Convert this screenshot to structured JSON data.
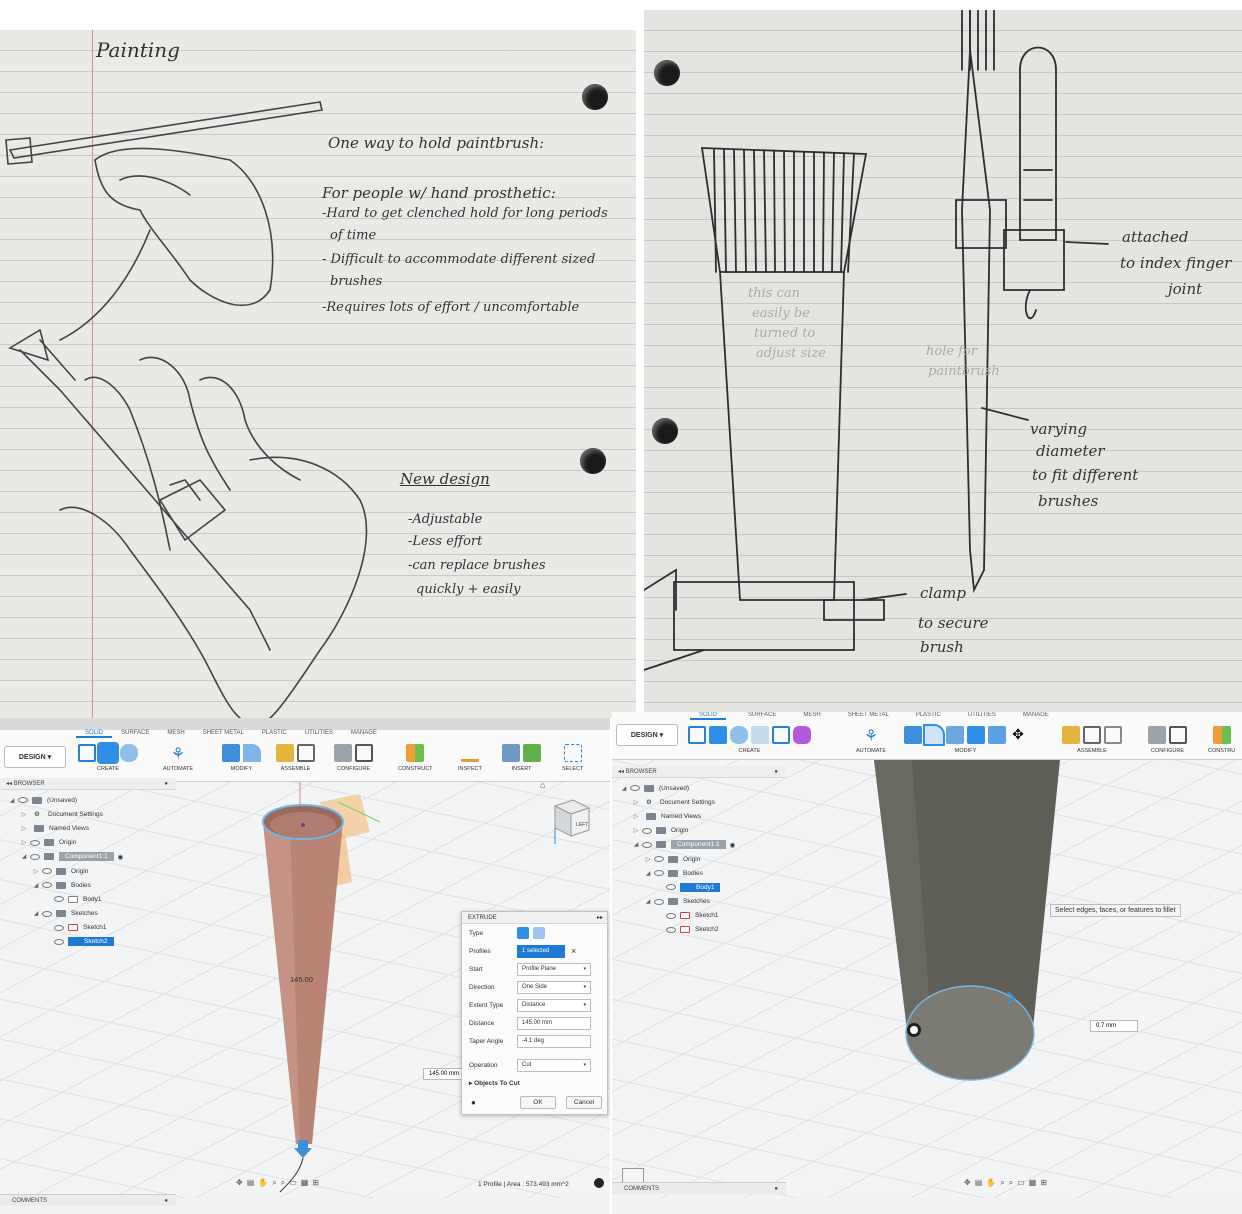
{
  "sketch_left": {
    "title": "Painting",
    "heading": "One way to hold paintbrush:",
    "subheading": "For people w/ hand prosthetic:",
    "problems": [
      "-Hard to get clenched hold for long periods",
      "of time",
      "- Difficult to accommodate different sized",
      "brushes",
      "-Requires lots of effort / uncomfortable"
    ],
    "new_design_title": "New design",
    "new_design_points": [
      "-Adjustable",
      "-Less effort",
      "-can replace brushes",
      "quickly + easily"
    ]
  },
  "sketch_right": {
    "notes": [
      "attached",
      "to index finger",
      "joint",
      "varying",
      "diameter",
      "to fit different",
      "brushes",
      "clamp",
      "to secure",
      "brush"
    ],
    "faint_notes": [
      "this can",
      "easily be",
      "turned to",
      "adjust size",
      "hole for",
      "paintbrush"
    ]
  },
  "cad_left": {
    "design_label": "DESIGN",
    "tabs": [
      "SOLID",
      "SURFACE",
      "MESH",
      "SHEET METAL",
      "PLASTIC",
      "UTILITIES",
      "MANAGE"
    ],
    "active_tab": "SOLID",
    "tool_groups": [
      "CREATE",
      "AUTOMATE",
      "MODIFY",
      "ASSEMBLE",
      "CONFIGURE",
      "CONSTRUCT",
      "INSPECT",
      "INSERT",
      "SELECT"
    ],
    "browser_label": "BROWSER",
    "tree": [
      {
        "label": "(Unsaved)"
      },
      {
        "label": "Document Settings"
      },
      {
        "label": "Named Views"
      },
      {
        "label": "Origin"
      },
      {
        "label": "Component1:1"
      },
      {
        "label": "Origin"
      },
      {
        "label": "Bodies"
      },
      {
        "label": "Body1"
      },
      {
        "label": "Sketches"
      },
      {
        "label": "Sketch1"
      },
      {
        "label": "Sketch2"
      }
    ],
    "viewcube_label": "LEFT",
    "model_dimension": "145.00",
    "dialog": {
      "title": "EXTRUDE",
      "type_label": "Type",
      "profiles_label": "Profiles",
      "profiles_value": "1 selected",
      "start_label": "Start",
      "start_value": "Profile Plane",
      "direction_label": "Direction",
      "direction_value": "One Side",
      "extent_label": "Extent Type",
      "extent_value": "Distance",
      "distance_label": "Distance",
      "distance_value": "145.00 mm",
      "taper_label": "Taper Angle",
      "taper_value": "-4.1 deg",
      "operation_label": "Operation",
      "operation_value": "Cut",
      "objects_label": "Objects To Cut",
      "ok": "OK",
      "cancel": "Cancel"
    },
    "distance_input": "145.00 mm",
    "comments_label": "COMMENTS",
    "status_text": "1 Profile | Area : 573.493 mm^2"
  },
  "cad_right": {
    "design_label": "DESIGN",
    "tabs": [
      "SOLID",
      "SURFACE",
      "MESH",
      "SHEET METAL",
      "PLASTIC",
      "UTILITIES",
      "MANAGE"
    ],
    "active_tab": "SOLID",
    "tool_groups": [
      "CREATE",
      "AUTOMATE",
      "MODIFY",
      "ASSEMBLE",
      "CONFIGURE",
      "CONSTRU"
    ],
    "browser_label": "BROWSER",
    "tree": [
      {
        "label": "(Unsaved)"
      },
      {
        "label": "Document Settings"
      },
      {
        "label": "Named Views"
      },
      {
        "label": "Origin"
      },
      {
        "label": "Component1:1"
      },
      {
        "label": "Origin"
      },
      {
        "label": "Bodies"
      },
      {
        "label": "Body1"
      },
      {
        "label": "Sketches"
      },
      {
        "label": "Sketch1"
      },
      {
        "label": "Sketch2"
      }
    ],
    "tooltip": "Select edges, faces, or features to fillet",
    "fillet_input": "0.7 mm",
    "comments_label": "COMMENTS"
  },
  "colors": {
    "accent": "#1b7fd6",
    "model_body": "#b98474",
    "fillet_body": "#7b7b74",
    "selection_highlight": "#1f7ad4"
  }
}
